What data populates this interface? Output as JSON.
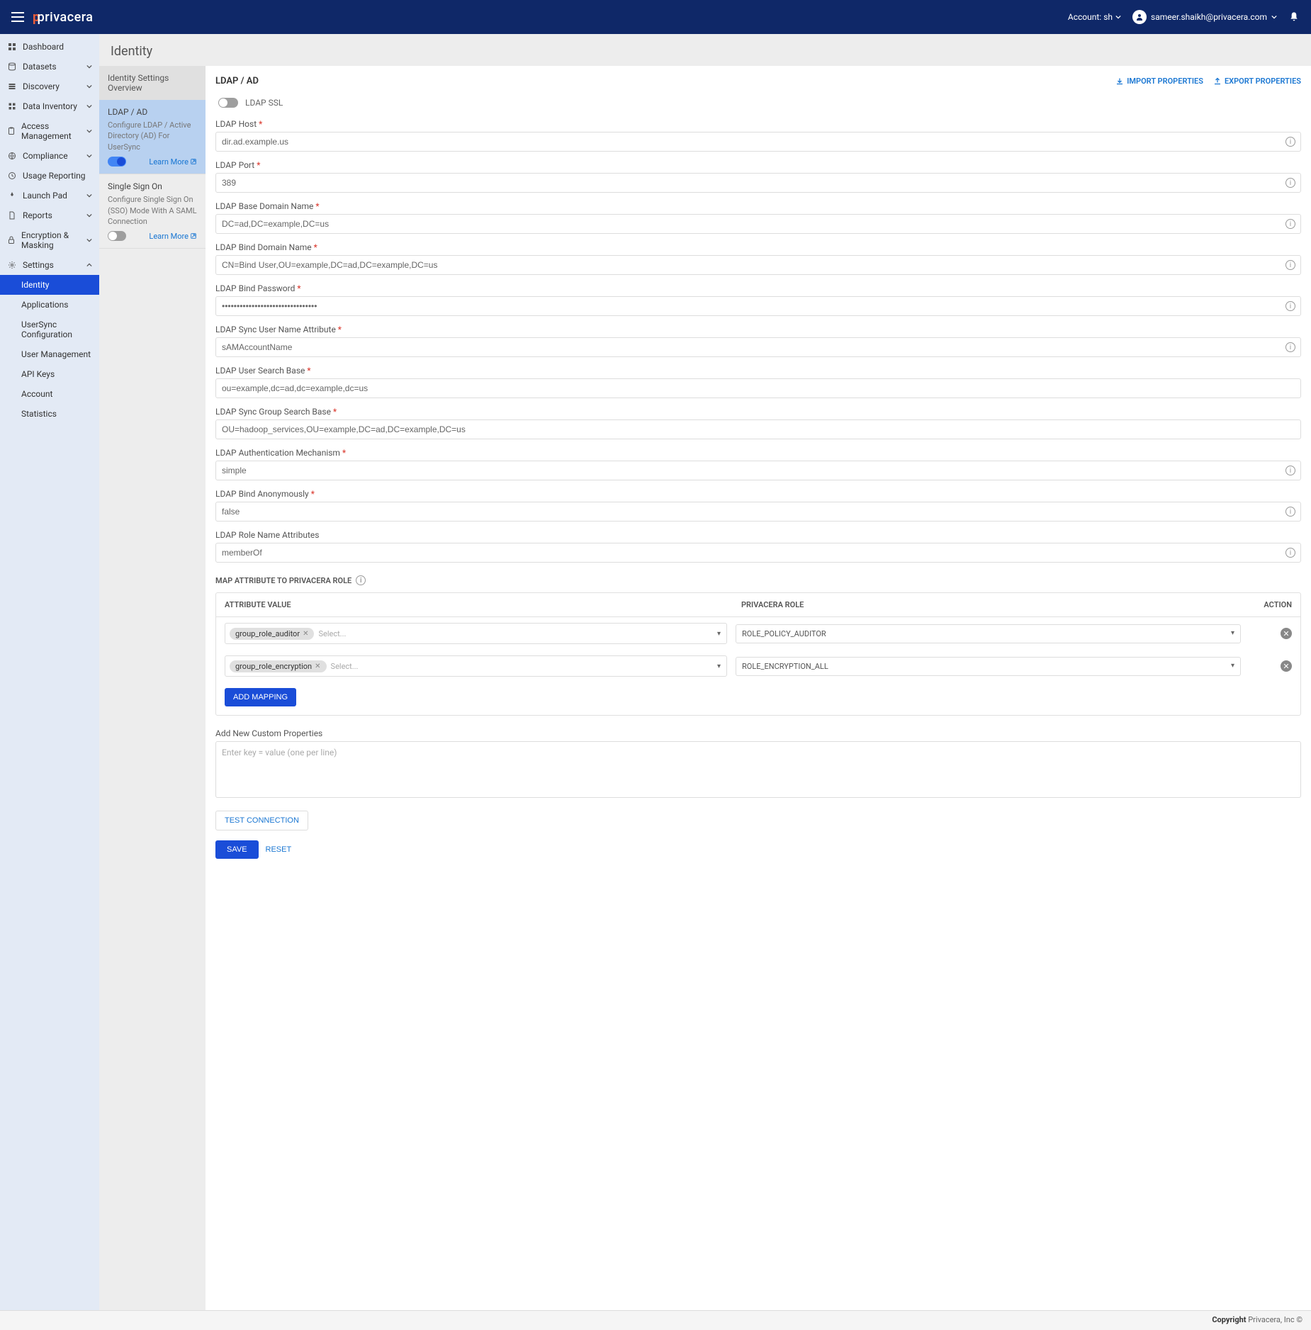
{
  "header": {
    "logo": "privacera",
    "account_label": "Account: sh",
    "user_email": "sameer.shaikh@privacera.com"
  },
  "sidebar": {
    "items": [
      {
        "label": "Dashboard",
        "icon": "grid",
        "expandable": false
      },
      {
        "label": "Datasets",
        "icon": "database",
        "expandable": true
      },
      {
        "label": "Discovery",
        "icon": "layers",
        "expandable": true
      },
      {
        "label": "Data Inventory",
        "icon": "grid4",
        "expandable": true
      },
      {
        "label": "Access Management",
        "icon": "clipboard",
        "expandable": true
      },
      {
        "label": "Compliance",
        "icon": "globe",
        "expandable": true
      },
      {
        "label": "Usage Reporting",
        "icon": "clock",
        "expandable": false
      },
      {
        "label": "Launch Pad",
        "icon": "rocket",
        "expandable": true
      },
      {
        "label": "Reports",
        "icon": "file",
        "expandable": true
      },
      {
        "label": "Encryption & Masking",
        "icon": "lock",
        "expandable": true
      },
      {
        "label": "Settings",
        "icon": "gear",
        "expandable": true,
        "expanded": true
      }
    ],
    "settings_sub": [
      {
        "label": "Identity",
        "active": true
      },
      {
        "label": "Applications"
      },
      {
        "label": "UserSync Configuration"
      },
      {
        "label": "User Management"
      },
      {
        "label": "API Keys"
      },
      {
        "label": "Account"
      },
      {
        "label": "Statistics"
      }
    ]
  },
  "page": {
    "title": "Identity",
    "sub_header": "Identity Settings Overview",
    "cards": [
      {
        "title": "LDAP / AD",
        "desc": "Configure LDAP / Active Directory (AD) For UserSync",
        "enabled": true,
        "active": true,
        "learn_more": "Learn More"
      },
      {
        "title": "Single Sign On",
        "desc": "Configure Single Sign On (SSO) Mode With A SAML Connection",
        "enabled": false,
        "active": false,
        "learn_more": "Learn More"
      }
    ]
  },
  "main": {
    "title": "LDAP / AD",
    "import_label": "IMPORT PROPERTIES",
    "export_label": "EXPORT PROPERTIES",
    "ssl_label": "LDAP SSL",
    "fields": [
      {
        "label": "LDAP Host",
        "value": "dir.ad.example.us",
        "required": true,
        "info": true
      },
      {
        "label": "LDAP Port",
        "value": "389",
        "required": true,
        "info": true
      },
      {
        "label": "LDAP Base Domain Name",
        "value": "DC=ad,DC=example,DC=us",
        "required": true,
        "info": true
      },
      {
        "label": "LDAP Bind Domain Name",
        "value": "CN=Bind User,OU=example,DC=ad,DC=example,DC=us",
        "required": true,
        "info": true
      },
      {
        "label": "LDAP Bind Password",
        "value": "••••••••••••••••••••••••••••••••",
        "required": true,
        "info": true
      },
      {
        "label": "LDAP Sync User Name Attribute",
        "value": "sAMAccountName",
        "required": true,
        "info": true
      },
      {
        "label": "LDAP User Search Base",
        "value": "ou=example,dc=ad,dc=example,dc=us",
        "required": true,
        "info": false
      },
      {
        "label": "LDAP Sync Group Search Base",
        "value": "OU=hadoop_services,OU=example,DC=ad,DC=example,DC=us",
        "required": true,
        "info": false
      },
      {
        "label": "LDAP Authentication Mechanism",
        "value": "simple",
        "required": true,
        "info": true
      },
      {
        "label": "LDAP Bind Anonymously",
        "value": "false",
        "required": true,
        "info": true
      },
      {
        "label": "LDAP Role Name Attributes",
        "value": "memberOf",
        "required": false,
        "info": true
      }
    ],
    "mapping_title": "MAP ATTRIBUTE TO PRIVACERA ROLE",
    "mapping_cols": {
      "attr": "ATTRIBUTE VALUE",
      "role": "PRIVACERA ROLE",
      "action": "ACTION"
    },
    "mappings": [
      {
        "chip": "group_role_auditor",
        "placeholder": "Select...",
        "role": "ROLE_POLICY_AUDITOR"
      },
      {
        "chip": "group_role_encryption",
        "placeholder": "Select...",
        "role": "ROLE_ENCRYPTION_ALL"
      }
    ],
    "add_mapping": "ADD MAPPING",
    "custom_label": "Add New Custom Properties",
    "custom_placeholder": "Enter key = value (one per line)",
    "test_connection": "TEST CONNECTION",
    "save": "SAVE",
    "reset": "RESET"
  },
  "footer": {
    "copyright": "Copyright",
    "text": " Privacera, Inc ©"
  }
}
